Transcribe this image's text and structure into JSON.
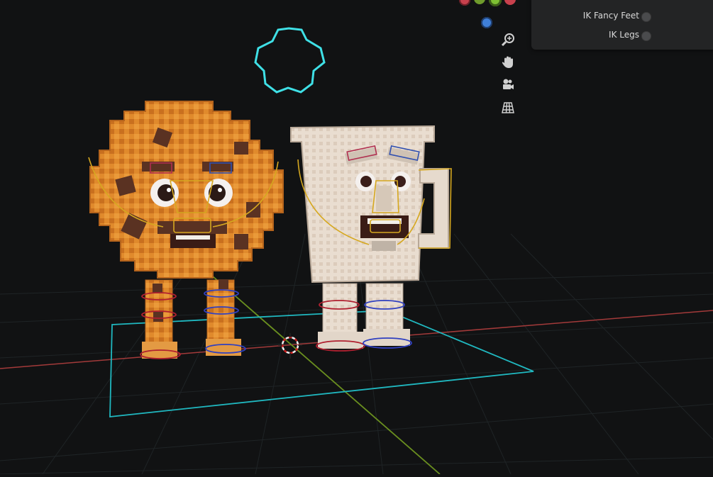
{
  "viewport": {
    "background": "#111213",
    "gizmo": {
      "axes": [
        {
          "name": "x-neg",
          "color": "#c8414d"
        },
        {
          "name": "y-neg",
          "color": "#6f9b2c"
        },
        {
          "name": "z-pos",
          "color": "#7ec033"
        },
        {
          "name": "x-pos",
          "color": "#c8414d"
        },
        {
          "name": "z-neg",
          "color": "#3f7fd8"
        }
      ]
    },
    "nav_tools": [
      "zoom-icon",
      "hand-pan-icon",
      "camera-icon",
      "grid-perspective-icon"
    ],
    "scene": {
      "x_axis_color": "#a33a3a",
      "y_axis_color": "#6a8f1f",
      "selection_color": "#20c0c8",
      "rig_color": "#d6a820",
      "characters": [
        "cookie-character",
        "milk-cup-character"
      ]
    }
  },
  "ik_panel": {
    "rows": [
      {
        "label": "IK Fancy Feet",
        "enabled": false
      },
      {
        "label": "IK Legs",
        "enabled": false
      }
    ]
  }
}
